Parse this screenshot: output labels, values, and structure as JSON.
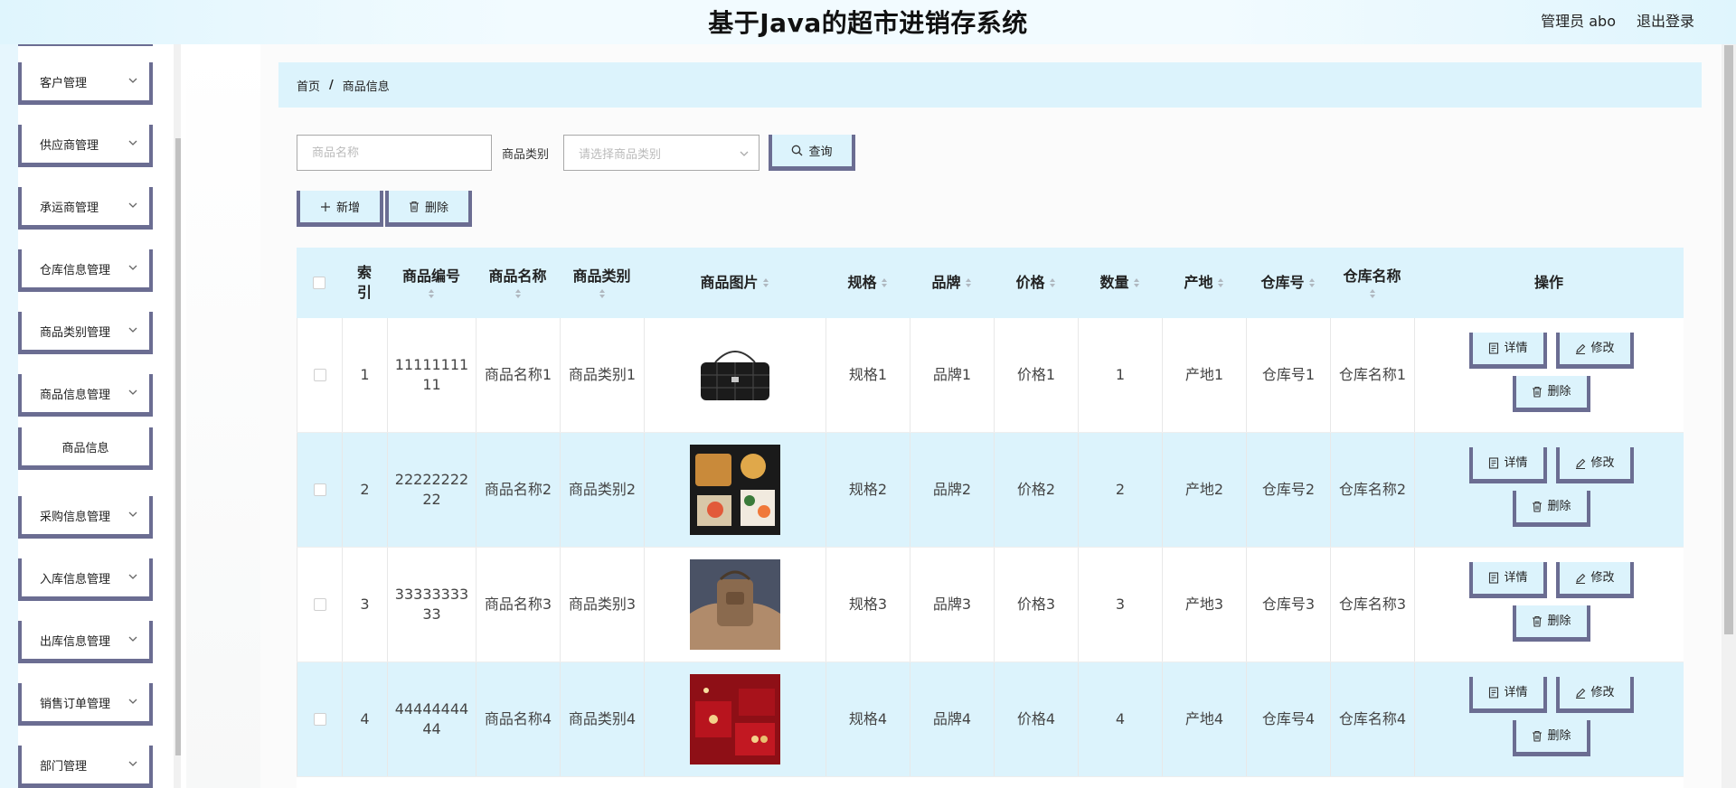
{
  "header": {
    "title": "基于Java的超市进销存系统",
    "user": "管理员 abo",
    "logout": "退出登录"
  },
  "sidebar": {
    "items": [
      {
        "label": "客户管理"
      },
      {
        "label": "供应商管理"
      },
      {
        "label": "承运商管理"
      },
      {
        "label": "仓库信息管理"
      },
      {
        "label": "商品类别管理"
      },
      {
        "label": "商品信息管理"
      },
      {
        "label": "商品信息"
      },
      {
        "label": "采购信息管理"
      },
      {
        "label": "入库信息管理"
      },
      {
        "label": "出库信息管理"
      },
      {
        "label": "销售订单管理"
      },
      {
        "label": "部门管理"
      }
    ]
  },
  "breadcrumb": {
    "home": "首页",
    "sep": "/",
    "current": "商品信息"
  },
  "search": {
    "name_placeholder": "商品名称",
    "category_label": "商品类别",
    "category_placeholder": "请选择商品类别",
    "query_label": "查询"
  },
  "toolbar": {
    "add_label": "新增",
    "delete_label": "删除"
  },
  "table": {
    "headers": {
      "index": "索引",
      "code": "商品编号",
      "name": "商品名称",
      "category": "商品类别",
      "image": "商品图片",
      "spec": "规格",
      "brand": "品牌",
      "price": "价格",
      "qty": "数量",
      "origin": "产地",
      "wh_no": "仓库号",
      "wh_name": "仓库名称",
      "ops": "操作"
    },
    "rows": [
      {
        "index": "1",
        "code": "1111111111",
        "name": "商品名称1",
        "category": "商品类别1",
        "spec": "规格1",
        "brand": "品牌1",
        "price": "价格1",
        "qty": "1",
        "origin": "产地1",
        "wh_no": "仓库号1",
        "wh_name": "仓库名称1"
      },
      {
        "index": "2",
        "code": "2222222222",
        "name": "商品名称2",
        "category": "商品类别2",
        "spec": "规格2",
        "brand": "品牌2",
        "price": "价格2",
        "qty": "2",
        "origin": "产地2",
        "wh_no": "仓库号2",
        "wh_name": "仓库名称2"
      },
      {
        "index": "3",
        "code": "3333333333",
        "name": "商品名称3",
        "category": "商品类别3",
        "spec": "规格3",
        "brand": "品牌3",
        "price": "价格3",
        "qty": "3",
        "origin": "产地3",
        "wh_no": "仓库号3",
        "wh_name": "仓库名称3"
      },
      {
        "index": "4",
        "code": "4444444444",
        "name": "商品名称4",
        "category": "商品类别4",
        "spec": "规格4",
        "brand": "品牌4",
        "price": "价格4",
        "qty": "4",
        "origin": "产地4",
        "wh_no": "仓库号4",
        "wh_name": "仓库名称4"
      }
    ],
    "actions": {
      "detail": "详情",
      "edit": "修改",
      "delete": "删除"
    }
  },
  "colors": {
    "accent_light": "#dcf3fc",
    "border_accent": "#6b6d92"
  }
}
